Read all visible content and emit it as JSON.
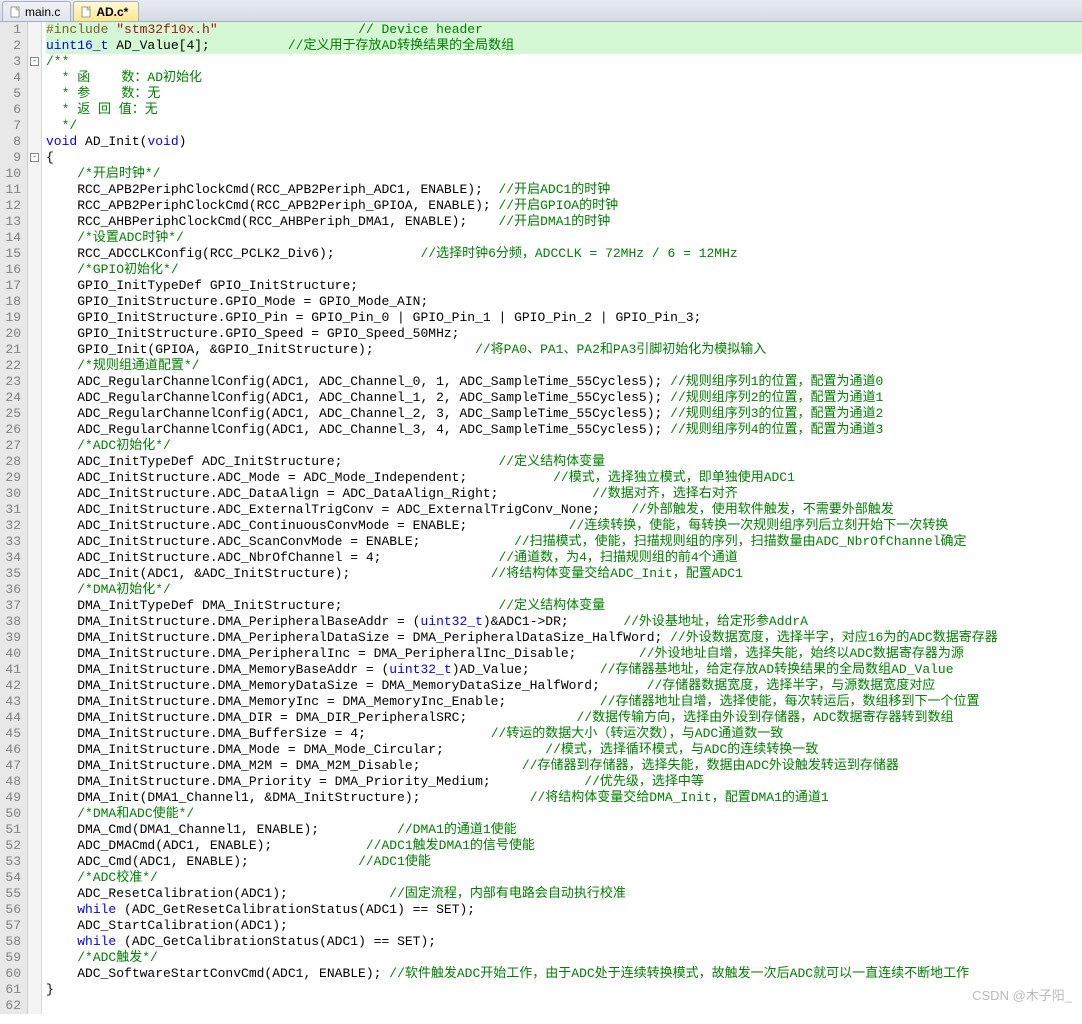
{
  "tabs": [
    {
      "label": "main.c",
      "active": false
    },
    {
      "label": "AD.c*",
      "active": true
    }
  ],
  "watermark": "CSDN @木子阳_",
  "lines": [
    {
      "n": 1,
      "hl": true,
      "fold": "",
      "tokens": [
        {
          "c": "pp",
          "t": "#include"
        },
        {
          "c": "",
          "t": " "
        },
        {
          "c": "str",
          "t": "\"stm32f10x.h\""
        },
        {
          "c": "",
          "t": "                  "
        },
        {
          "c": "cm",
          "t": "// Device header"
        }
      ]
    },
    {
      "n": 2,
      "hl": true,
      "fold": "",
      "tokens": [
        {
          "c": "ty",
          "t": "uint16_t"
        },
        {
          "c": "",
          "t": " AD_Value["
        },
        {
          "c": "num",
          "t": "4"
        },
        {
          "c": "",
          "t": "];          "
        },
        {
          "c": "cm",
          "t": "//定义用于存放AD转换结果的全局数组"
        }
      ]
    },
    {
      "n": 3,
      "fold": "-",
      "tokens": [
        {
          "c": "cm",
          "t": "/**"
        }
      ]
    },
    {
      "n": 4,
      "fold": "",
      "tokens": [
        {
          "c": "cm",
          "t": "  * 函    数：AD初始化"
        }
      ]
    },
    {
      "n": 5,
      "fold": "",
      "tokens": [
        {
          "c": "cm",
          "t": "  * 参    数：无"
        }
      ]
    },
    {
      "n": 6,
      "fold": "",
      "tokens": [
        {
          "c": "cm",
          "t": "  * 返 回 值：无"
        }
      ]
    },
    {
      "n": 7,
      "fold": "",
      "tokens": [
        {
          "c": "cm",
          "t": "  */"
        }
      ]
    },
    {
      "n": 8,
      "fold": "",
      "tokens": [
        {
          "c": "kw",
          "t": "void"
        },
        {
          "c": "",
          "t": " AD_Init("
        },
        {
          "c": "kw",
          "t": "void"
        },
        {
          "c": "",
          "t": ")"
        }
      ]
    },
    {
      "n": 9,
      "fold": "-",
      "tokens": [
        {
          "c": "",
          "t": "{"
        }
      ]
    },
    {
      "n": 10,
      "fold": "",
      "tokens": [
        {
          "c": "",
          "t": "    "
        },
        {
          "c": "cm",
          "t": "/*开启时钟*/"
        }
      ]
    },
    {
      "n": 11,
      "fold": "",
      "tokens": [
        {
          "c": "",
          "t": "    RCC_APB2PeriphClockCmd(RCC_APB2Periph_ADC1, ENABLE);  "
        },
        {
          "c": "cm",
          "t": "//开启ADC1的时钟"
        }
      ]
    },
    {
      "n": 12,
      "fold": "",
      "tokens": [
        {
          "c": "",
          "t": "    RCC_APB2PeriphClockCmd(RCC_APB2Periph_GPIOA, ENABLE); "
        },
        {
          "c": "cm",
          "t": "//开启GPIOA的时钟"
        }
      ]
    },
    {
      "n": 13,
      "fold": "",
      "tokens": [
        {
          "c": "",
          "t": "    RCC_AHBPeriphClockCmd(RCC_AHBPeriph_DMA1, ENABLE);    "
        },
        {
          "c": "cm",
          "t": "//开启DMA1的时钟"
        }
      ]
    },
    {
      "n": 14,
      "fold": "",
      "tokens": [
        {
          "c": "",
          "t": "    "
        },
        {
          "c": "cm",
          "t": "/*设置ADC时钟*/"
        }
      ]
    },
    {
      "n": 15,
      "fold": "",
      "tokens": [
        {
          "c": "",
          "t": "    RCC_ADCCLKConfig(RCC_PCLK2_Div6);           "
        },
        {
          "c": "cm",
          "t": "//选择时钟6分频，ADCCLK = 72MHz / 6 = 12MHz"
        }
      ]
    },
    {
      "n": 16,
      "fold": "",
      "tokens": [
        {
          "c": "",
          "t": "    "
        },
        {
          "c": "cm",
          "t": "/*GPIO初始化*/"
        }
      ]
    },
    {
      "n": 17,
      "fold": "",
      "tokens": [
        {
          "c": "",
          "t": "    GPIO_InitTypeDef GPIO_InitStructure;"
        }
      ]
    },
    {
      "n": 18,
      "fold": "",
      "tokens": [
        {
          "c": "",
          "t": "    GPIO_InitStructure.GPIO_Mode = GPIO_Mode_AIN;"
        }
      ]
    },
    {
      "n": 19,
      "fold": "",
      "tokens": [
        {
          "c": "",
          "t": "    GPIO_InitStructure.GPIO_Pin = GPIO_Pin_0 | GPIO_Pin_1 | GPIO_Pin_2 | GPIO_Pin_3;"
        }
      ]
    },
    {
      "n": 20,
      "fold": "",
      "tokens": [
        {
          "c": "",
          "t": "    GPIO_InitStructure.GPIO_Speed = GPIO_Speed_50MHz;"
        }
      ]
    },
    {
      "n": 21,
      "fold": "",
      "tokens": [
        {
          "c": "",
          "t": "    GPIO_Init(GPIOA, &GPIO_InitStructure);             "
        },
        {
          "c": "cm",
          "t": "//将PA0、PA1、PA2和PA3引脚初始化为模拟输入"
        }
      ]
    },
    {
      "n": 22,
      "fold": "",
      "tokens": [
        {
          "c": "",
          "t": "    "
        },
        {
          "c": "cm",
          "t": "/*规则组通道配置*/"
        }
      ]
    },
    {
      "n": 23,
      "fold": "",
      "tokens": [
        {
          "c": "",
          "t": "    ADC_RegularChannelConfig(ADC1, ADC_Channel_0, "
        },
        {
          "c": "num",
          "t": "1"
        },
        {
          "c": "",
          "t": ", ADC_SampleTime_55Cycles5); "
        },
        {
          "c": "cm",
          "t": "//规则组序列1的位置，配置为通道0"
        }
      ]
    },
    {
      "n": 24,
      "fold": "",
      "tokens": [
        {
          "c": "",
          "t": "    ADC_RegularChannelConfig(ADC1, ADC_Channel_1, "
        },
        {
          "c": "num",
          "t": "2"
        },
        {
          "c": "",
          "t": ", ADC_SampleTime_55Cycles5); "
        },
        {
          "c": "cm",
          "t": "//规则组序列2的位置，配置为通道1"
        }
      ]
    },
    {
      "n": 25,
      "fold": "",
      "tokens": [
        {
          "c": "",
          "t": "    ADC_RegularChannelConfig(ADC1, ADC_Channel_2, "
        },
        {
          "c": "num",
          "t": "3"
        },
        {
          "c": "",
          "t": ", ADC_SampleTime_55Cycles5); "
        },
        {
          "c": "cm",
          "t": "//规则组序列3的位置，配置为通道2"
        }
      ]
    },
    {
      "n": 26,
      "fold": "",
      "tokens": [
        {
          "c": "",
          "t": "    ADC_RegularChannelConfig(ADC1, ADC_Channel_3, "
        },
        {
          "c": "num",
          "t": "4"
        },
        {
          "c": "",
          "t": ", ADC_SampleTime_55Cycles5); "
        },
        {
          "c": "cm",
          "t": "//规则组序列4的位置，配置为通道3"
        }
      ]
    },
    {
      "n": 27,
      "fold": "",
      "tokens": [
        {
          "c": "",
          "t": "    "
        },
        {
          "c": "cm",
          "t": "/*ADC初始化*/"
        }
      ]
    },
    {
      "n": 28,
      "fold": "",
      "tokens": [
        {
          "c": "",
          "t": "    ADC_InitTypeDef ADC_InitStructure;                    "
        },
        {
          "c": "cm",
          "t": "//定义结构体变量"
        }
      ]
    },
    {
      "n": 29,
      "fold": "",
      "tokens": [
        {
          "c": "",
          "t": "    ADC_InitStructure.ADC_Mode = ADC_Mode_Independent;           "
        },
        {
          "c": "cm",
          "t": "//模式，选择独立模式，即单独使用ADC1"
        }
      ]
    },
    {
      "n": 30,
      "fold": "",
      "tokens": [
        {
          "c": "",
          "t": "    ADC_InitStructure.ADC_DataAlign = ADC_DataAlign_Right;            "
        },
        {
          "c": "cm",
          "t": "//数据对齐，选择右对齐"
        }
      ]
    },
    {
      "n": 31,
      "fold": "",
      "tokens": [
        {
          "c": "",
          "t": "    ADC_InitStructure.ADC_ExternalTrigConv = ADC_ExternalTrigConv_None;    "
        },
        {
          "c": "cm",
          "t": "//外部触发，使用软件触发，不需要外部触发"
        }
      ]
    },
    {
      "n": 32,
      "fold": "",
      "tokens": [
        {
          "c": "",
          "t": "    ADC_InitStructure.ADC_ContinuousConvMode = ENABLE;             "
        },
        {
          "c": "cm",
          "t": "//连续转换，使能，每转换一次规则组序列后立刻开始下一次转换"
        }
      ]
    },
    {
      "n": 33,
      "fold": "",
      "tokens": [
        {
          "c": "",
          "t": "    ADC_InitStructure.ADC_ScanConvMode = ENABLE;            "
        },
        {
          "c": "cm",
          "t": "//扫描模式，使能，扫描规则组的序列，扫描数量由ADC_NbrOfChannel确定"
        }
      ]
    },
    {
      "n": 34,
      "fold": "",
      "tokens": [
        {
          "c": "",
          "t": "    ADC_InitStructure.ADC_NbrOfChannel = "
        },
        {
          "c": "num",
          "t": "4"
        },
        {
          "c": "",
          "t": ";               "
        },
        {
          "c": "cm",
          "t": "//通道数，为4，扫描规则组的前4个通道"
        }
      ]
    },
    {
      "n": 35,
      "fold": "",
      "tokens": [
        {
          "c": "",
          "t": "    ADC_Init(ADC1, &ADC_InitStructure);                  "
        },
        {
          "c": "cm",
          "t": "//将结构体变量交给ADC_Init，配置ADC1"
        }
      ]
    },
    {
      "n": 36,
      "fold": "",
      "tokens": [
        {
          "c": "",
          "t": "    "
        },
        {
          "c": "cm",
          "t": "/*DMA初始化*/"
        }
      ]
    },
    {
      "n": 37,
      "fold": "",
      "tokens": [
        {
          "c": "",
          "t": "    DMA_InitTypeDef DMA_InitStructure;                    "
        },
        {
          "c": "cm",
          "t": "//定义结构体变量"
        }
      ]
    },
    {
      "n": 38,
      "fold": "",
      "tokens": [
        {
          "c": "",
          "t": "    DMA_InitStructure.DMA_PeripheralBaseAddr = ("
        },
        {
          "c": "ty",
          "t": "uint32_t"
        },
        {
          "c": "",
          "t": ")&ADC1->DR;       "
        },
        {
          "c": "cm",
          "t": "//外设基地址，给定形参AddrA"
        }
      ]
    },
    {
      "n": 39,
      "fold": "",
      "tokens": [
        {
          "c": "",
          "t": "    DMA_InitStructure.DMA_PeripheralDataSize = DMA_PeripheralDataSize_HalfWord; "
        },
        {
          "c": "cm",
          "t": "//外设数据宽度，选择半字，对应16为的ADC数据寄存器"
        }
      ]
    },
    {
      "n": 40,
      "fold": "",
      "tokens": [
        {
          "c": "",
          "t": "    DMA_InitStructure.DMA_PeripheralInc = DMA_PeripheralInc_Disable;        "
        },
        {
          "c": "cm",
          "t": "//外设地址自增，选择失能，始终以ADC数据寄存器为源"
        }
      ]
    },
    {
      "n": 41,
      "fold": "",
      "tokens": [
        {
          "c": "",
          "t": "    DMA_InitStructure.DMA_MemoryBaseAddr = ("
        },
        {
          "c": "ty",
          "t": "uint32_t"
        },
        {
          "c": "",
          "t": ")AD_Value;         "
        },
        {
          "c": "cm",
          "t": "//存储器基地址，给定存放AD转换结果的全局数组AD_Value"
        }
      ]
    },
    {
      "n": 42,
      "fold": "",
      "tokens": [
        {
          "c": "",
          "t": "    DMA_InitStructure.DMA_MemoryDataSize = DMA_MemoryDataSize_HalfWord;      "
        },
        {
          "c": "cm",
          "t": "//存储器数据宽度，选择半字，与源数据宽度对应"
        }
      ]
    },
    {
      "n": 43,
      "fold": "",
      "tokens": [
        {
          "c": "",
          "t": "    DMA_InitStructure.DMA_MemoryInc = DMA_MemoryInc_Enable;            "
        },
        {
          "c": "cm",
          "t": "//存储器地址自增，选择使能，每次转运后，数组移到下一个位置"
        }
      ]
    },
    {
      "n": 44,
      "fold": "",
      "tokens": [
        {
          "c": "",
          "t": "    DMA_InitStructure.DMA_DIR = DMA_DIR_PeripheralSRC;              "
        },
        {
          "c": "cm",
          "t": "//数据传输方向，选择由外设到存储器，ADC数据寄存器转到数组"
        }
      ]
    },
    {
      "n": 45,
      "fold": "",
      "tokens": [
        {
          "c": "",
          "t": "    DMA_InitStructure.DMA_BufferSize = "
        },
        {
          "c": "num",
          "t": "4"
        },
        {
          "c": "",
          "t": ";                "
        },
        {
          "c": "cm",
          "t": "//转运的数据大小（转运次数），与ADC通道数一致"
        }
      ]
    },
    {
      "n": 46,
      "fold": "",
      "tokens": [
        {
          "c": "",
          "t": "    DMA_InitStructure.DMA_Mode = DMA_Mode_Circular;             "
        },
        {
          "c": "cm",
          "t": "//模式，选择循环模式，与ADC的连续转换一致"
        }
      ]
    },
    {
      "n": 47,
      "fold": "",
      "tokens": [
        {
          "c": "",
          "t": "    DMA_InitStructure.DMA_M2M = DMA_M2M_Disable;             "
        },
        {
          "c": "cm",
          "t": "//存储器到存储器，选择失能，数据由ADC外设触发转运到存储器"
        }
      ]
    },
    {
      "n": 48,
      "fold": "",
      "tokens": [
        {
          "c": "",
          "t": "    DMA_InitStructure.DMA_Priority = DMA_Priority_Medium;            "
        },
        {
          "c": "cm",
          "t": "//优先级，选择中等"
        }
      ]
    },
    {
      "n": 49,
      "fold": "",
      "tokens": [
        {
          "c": "",
          "t": "    DMA_Init(DMA1_Channel1, &DMA_InitStructure);              "
        },
        {
          "c": "cm",
          "t": "//将结构体变量交给DMA_Init，配置DMA1的通道1"
        }
      ]
    },
    {
      "n": 50,
      "fold": "",
      "tokens": [
        {
          "c": "",
          "t": "    "
        },
        {
          "c": "cm",
          "t": "/*DMA和ADC使能*/"
        }
      ]
    },
    {
      "n": 51,
      "fold": "",
      "tokens": [
        {
          "c": "",
          "t": "    DMA_Cmd(DMA1_Channel1, ENABLE);          "
        },
        {
          "c": "cm",
          "t": "//DMA1的通道1使能"
        }
      ]
    },
    {
      "n": 52,
      "fold": "",
      "tokens": [
        {
          "c": "",
          "t": "    ADC_DMACmd(ADC1, ENABLE);            "
        },
        {
          "c": "cm",
          "t": "//ADC1触发DMA1的信号使能"
        }
      ]
    },
    {
      "n": 53,
      "fold": "",
      "tokens": [
        {
          "c": "",
          "t": "    ADC_Cmd(ADC1, ENABLE);              "
        },
        {
          "c": "cm",
          "t": "//ADC1使能"
        }
      ]
    },
    {
      "n": 54,
      "fold": "",
      "tokens": [
        {
          "c": "",
          "t": "    "
        },
        {
          "c": "cm",
          "t": "/*ADC校准*/"
        }
      ]
    },
    {
      "n": 55,
      "fold": "",
      "tokens": [
        {
          "c": "",
          "t": "    ADC_ResetCalibration(ADC1);             "
        },
        {
          "c": "cm",
          "t": "//固定流程，内部有电路会自动执行校准"
        }
      ]
    },
    {
      "n": 56,
      "fold": "",
      "tokens": [
        {
          "c": "",
          "t": "    "
        },
        {
          "c": "kw",
          "t": "while"
        },
        {
          "c": "",
          "t": " (ADC_GetResetCalibrationStatus(ADC1) == SET);"
        }
      ]
    },
    {
      "n": 57,
      "fold": "",
      "tokens": [
        {
          "c": "",
          "t": "    ADC_StartCalibration(ADC1);"
        }
      ]
    },
    {
      "n": 58,
      "fold": "",
      "tokens": [
        {
          "c": "",
          "t": "    "
        },
        {
          "c": "kw",
          "t": "while"
        },
        {
          "c": "",
          "t": " (ADC_GetCalibrationStatus(ADC1) == SET);"
        }
      ]
    },
    {
      "n": 59,
      "fold": "",
      "tokens": [
        {
          "c": "",
          "t": "    "
        },
        {
          "c": "cm",
          "t": "/*ADC触发*/"
        }
      ]
    },
    {
      "n": 60,
      "fold": "",
      "tokens": [
        {
          "c": "",
          "t": "    ADC_SoftwareStartConvCmd(ADC1, ENABLE); "
        },
        {
          "c": "cm",
          "t": "//软件触发ADC开始工作，由于ADC处于连续转换模式，故触发一次后ADC就可以一直连续不断地工作"
        }
      ]
    },
    {
      "n": 61,
      "fold": "",
      "tokens": [
        {
          "c": "",
          "t": "}"
        }
      ]
    },
    {
      "n": 62,
      "fold": "",
      "tokens": [
        {
          "c": "",
          "t": ""
        }
      ]
    }
  ]
}
